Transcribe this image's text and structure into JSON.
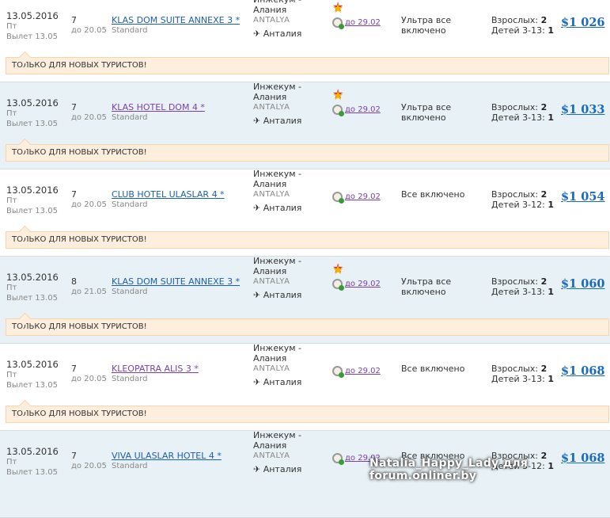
{
  "tours": [
    {
      "date": "13.05.2016",
      "weekday": "Пт",
      "departure": "Вылет 13.05",
      "nights": "7",
      "until": "до 20.05",
      "hotel": "KLAS DOM SUITE ANNEXE 3 *",
      "visited": false,
      "room": "Standard",
      "location": "Инжекум - Алания",
      "region": "ANTALYA",
      "airport": "Анталия",
      "star": true,
      "deadline": "до 29.02",
      "meal": "Ультра все включено",
      "adults_label": "Взрослых:",
      "adults": "2",
      "children_label": "Детей 3-13:",
      "children": "1",
      "price": "$1 026",
      "note": "ТОЛЬКО ДЛЯ НОВЫХ ТУРИСТОВ!"
    },
    {
      "date": "13.05.2016",
      "weekday": "Пт",
      "departure": "Вылет 13.05",
      "nights": "7",
      "until": "до 20.05",
      "hotel": "KLAS HOTEL DOM 4 *",
      "visited": true,
      "room": "Standard",
      "location": "Инжекум - Алания",
      "region": "ANTALYA",
      "airport": "Анталия",
      "star": true,
      "deadline": "до 29.02",
      "meal": "Ультра все включено",
      "adults_label": "Взрослых:",
      "adults": "2",
      "children_label": "Детей 3-13:",
      "children": "1",
      "price": "$1 033",
      "note": "ТОЛЬКО ДЛЯ НОВЫХ ТУРИСТОВ!"
    },
    {
      "date": "13.05.2016",
      "weekday": "Пт",
      "departure": "Вылет 13.05",
      "nights": "7",
      "until": "до 20.05",
      "hotel": "CLUB HOTEL ULASLAR 4 *",
      "visited": false,
      "room": "Standard",
      "location": "Инжекум - Алания",
      "region": "ANTALYA",
      "airport": "Анталия",
      "star": false,
      "deadline": "до 29.02",
      "meal": "Все включено",
      "adults_label": "Взрослых:",
      "adults": "2",
      "children_label": "Детей 3-12:",
      "children": "1",
      "price": "$1 054",
      "note": "ТОЛЬКО ДЛЯ НОВЫХ ТУРИСТОВ!"
    },
    {
      "date": "13.05.2016",
      "weekday": "Пт",
      "departure": "Вылет 13.05",
      "nights": "8",
      "until": "до 21.05",
      "hotel": "KLAS DOM SUITE ANNEXE 3 *",
      "visited": false,
      "room": "Standard",
      "location": "Инжекум - Алания",
      "region": "ANTALYA",
      "airport": "Анталия",
      "star": true,
      "deadline": "до 29.02",
      "meal": "Ультра все включено",
      "adults_label": "Взрослых:",
      "adults": "2",
      "children_label": "Детей 3-13:",
      "children": "1",
      "price": "$1 060",
      "note": "ТОЛЬКО ДЛЯ НОВЫХ ТУРИСТОВ!"
    },
    {
      "date": "13.05.2016",
      "weekday": "Пт",
      "departure": "Вылет 13.05",
      "nights": "7",
      "until": "до 20.05",
      "hotel": "KLEOPATRA ALIS 3 *",
      "visited": true,
      "room": "Standard",
      "location": "Инжекум - Алания",
      "region": "ANTALYA",
      "airport": "Анталия",
      "star": false,
      "deadline": "до 29.02",
      "meal": "Все включено",
      "adults_label": "Взрослых:",
      "adults": "2",
      "children_label": "Детей 3-13:",
      "children": "1",
      "price": "$1 068",
      "note": "ТОЛЬКО ДЛЯ НОВЫХ ТУРИСТОВ!"
    },
    {
      "date": "13.05.2016",
      "weekday": "Пт",
      "departure": "Вылет 13.05",
      "nights": "7",
      "until": "до 20.05",
      "hotel": "VIVA ULASLAR HOTEL 4 *",
      "visited": false,
      "room": "Standard",
      "location": "Инжекум - Алания",
      "region": "ANTALYA",
      "airport": "Анталия",
      "star": false,
      "deadline": "до 29.02",
      "meal": "Все включено",
      "adults_label": "Взрослых:",
      "adults": "2",
      "children_label": "Детей 3-12:",
      "children": "1",
      "price": "$1 068",
      "note": null
    }
  ],
  "watermark": "Natalia_Happy_Lady для forum.onliner.by"
}
